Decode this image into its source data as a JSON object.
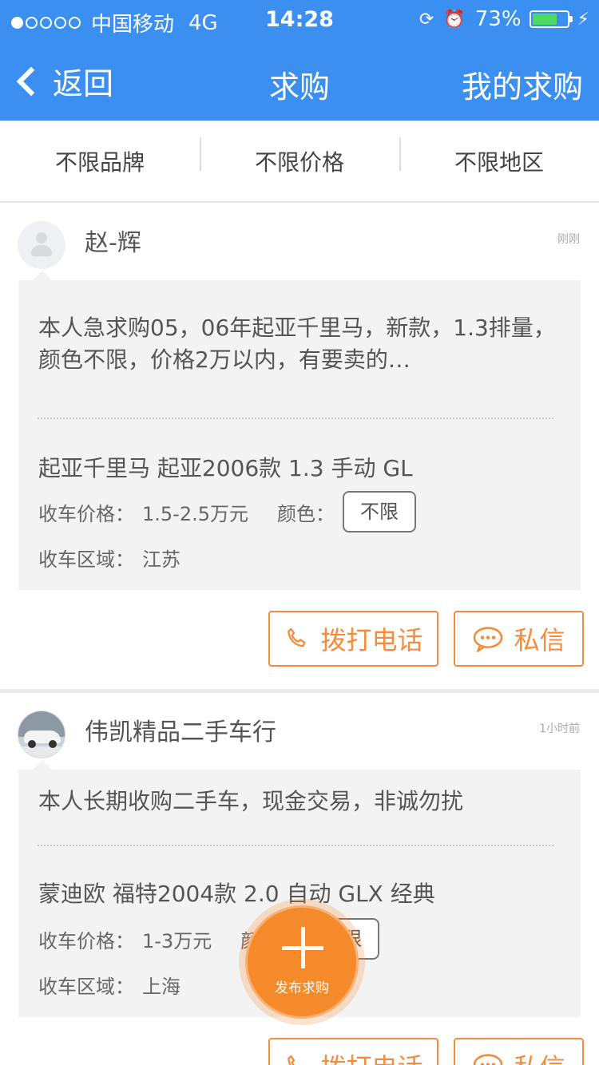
{
  "status_bar": {
    "carrier": "中国移动",
    "network": "4G",
    "time": "14:28",
    "battery": "73%",
    "battery_level": 0.73
  },
  "nav": {
    "back_label": "返回",
    "title": "求购",
    "right_label": "我的求购"
  },
  "filters": [
    "不限品牌",
    "不限价格",
    "不限地区"
  ],
  "posts": [
    {
      "user": "赵-辉",
      "time": "刚刚",
      "description": "本人急求购05，06年起亚千里马，新款，1.3排量，颜色不限，价格2万以内，有要卖的…",
      "model": "起亚千里马 起亚2006款 1.3 手动 GL",
      "price_label": "收车价格：",
      "price": "1.5-2.5万元",
      "color_label": "颜色：",
      "color": "不限",
      "region_label": "收车区域：",
      "region": "江苏",
      "call_label": "拨打电话",
      "message_label": "私信"
    },
    {
      "user": "伟凯精品二手车行",
      "time": "1小时前",
      "description": "本人长期收购二手车，现金交易，非诚勿扰",
      "model": "蒙迪欧 福特2004款 2.0 自动 GLX 经典",
      "price_label": "收车价格：",
      "price": "1-3万元",
      "color_label": "颜色：",
      "color": "不限",
      "region_label": "收车区域：",
      "region": "上海",
      "call_label": "拨打电话",
      "message_label": "私信"
    }
  ],
  "fab": {
    "label": "发布求购"
  },
  "colors": {
    "primary": "#3a8ff0",
    "accent": "#f68b3c"
  }
}
